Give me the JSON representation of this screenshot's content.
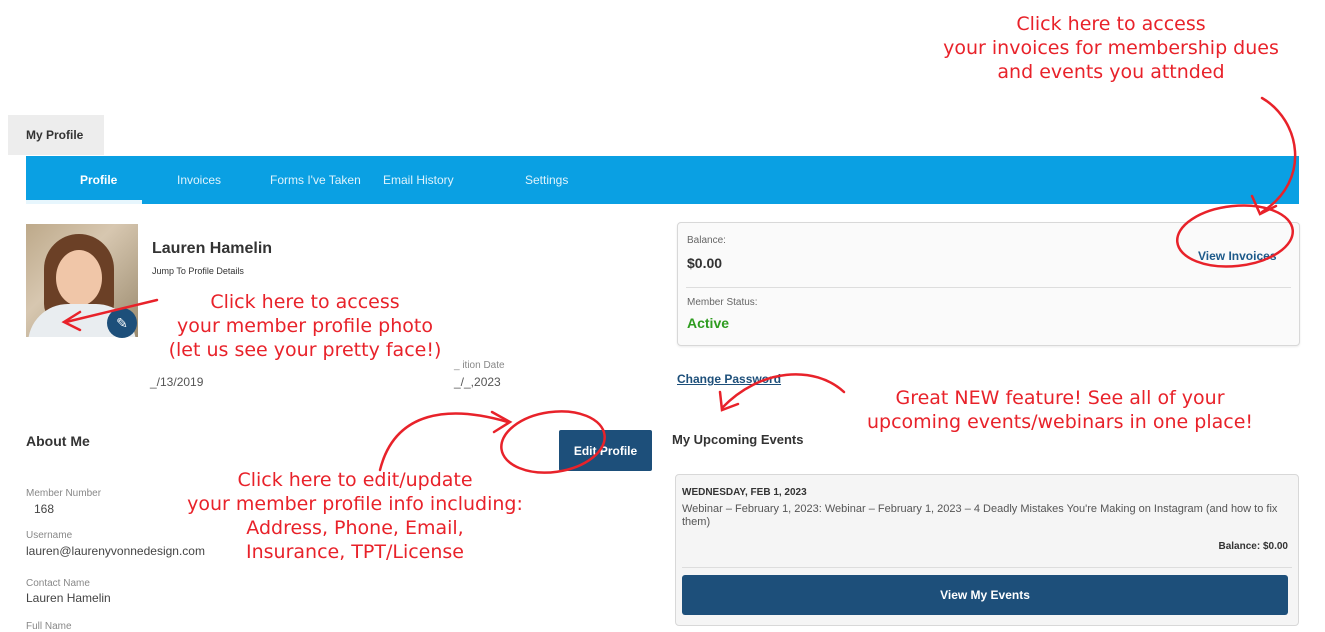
{
  "page_tab": "My Profile",
  "nav": {
    "tabs": [
      {
        "label": "Profile",
        "active": true
      },
      {
        "label": "Invoices"
      },
      {
        "label": "Forms I've Taken"
      },
      {
        "label": "Email History"
      },
      {
        "label": "Settings"
      }
    ]
  },
  "profile": {
    "name": "Lauren Hamelin",
    "jump_link": "Jump To Profile Details",
    "member_since_value": "_/13/2019",
    "expiration_label": "_ ition Date",
    "expiration_value": "_/_,2023"
  },
  "about": {
    "title": "About Me",
    "edit_button": "Edit Profile",
    "fields": [
      {
        "label": "Member Number",
        "value": "168"
      },
      {
        "label": "Username",
        "value": "lauren@laurenyvonnedesign.com"
      },
      {
        "label": "Contact Name",
        "value": "Lauren Hamelin"
      },
      {
        "label": "Full Name",
        "value": ""
      }
    ]
  },
  "balance_card": {
    "balance_label": "Balance:",
    "balance_value": "$0.00",
    "view_invoices": "View Invoices",
    "status_label": "Member Status:",
    "status_value": "Active"
  },
  "change_password": "Change Password",
  "events": {
    "title": "My Upcoming Events",
    "date": "WEDNESDAY, FEB 1, 2023",
    "event_title": "Webinar – February 1, 2023: Webinar – February 1, 2023 – 4 Deadly Mistakes You're Making on Instagram (and how to fix them)",
    "balance": "Balance: $0.00",
    "button": "View My Events"
  },
  "annotations": {
    "invoices_note": "Click here to access\nyour invoices for membership dues\nand events you attnded",
    "photo_note": "Click here to access\nyour member profile photo\n(let us see your pretty face!)",
    "edit_note": "Click here to edit/update\nyour member profile info including:\nAddress, Phone, Email,\nInsurance, TPT/License",
    "events_note": "Great NEW feature! See all of your\nupcoming events/webinars in one place!"
  },
  "colors": {
    "nav_blue": "#0aa0e3",
    "button_navy": "#1d4f7a",
    "annotation_red": "#e8222a",
    "active_green": "#2e9c1f"
  }
}
